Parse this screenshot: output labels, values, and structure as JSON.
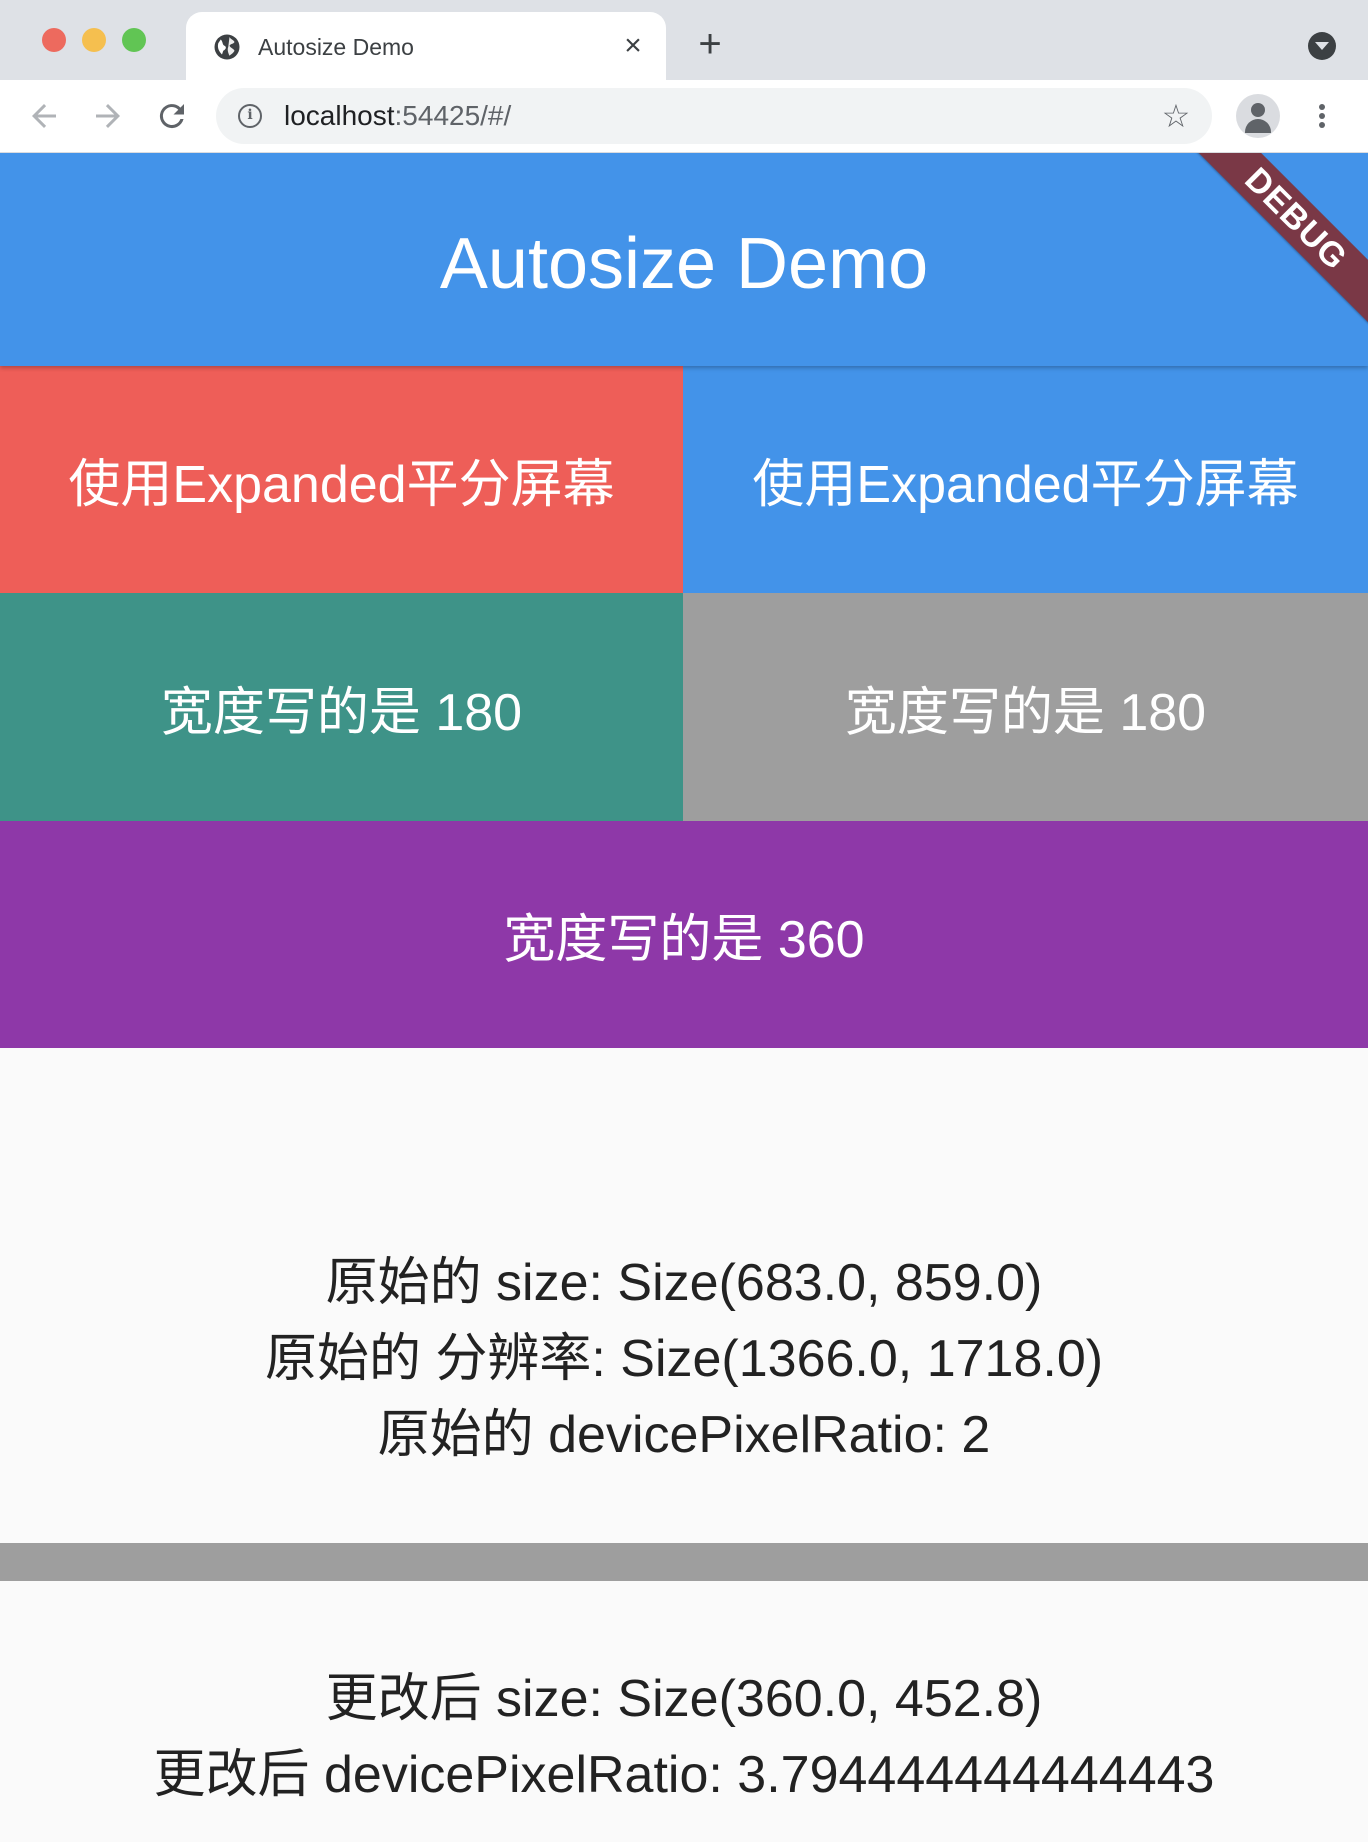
{
  "browser": {
    "tab_title": "Autosize Demo",
    "tab_close": "×",
    "new_tab": "+",
    "url_host": "localhost",
    "url_rest": ":54425/#/",
    "info_icon": "i",
    "star": "☆",
    "icons": [
      "globe-icon",
      "close-icon",
      "plus-icon",
      "tab-search-icon",
      "back-arrow-icon",
      "forward-arrow-icon",
      "reload-icon",
      "info-icon",
      "star-icon",
      "profile-icon",
      "kebab-menu-icon"
    ]
  },
  "appbar": {
    "title": "Autosize Demo",
    "debug_banner": "DEBUG",
    "color": "#4393e9"
  },
  "blocks": {
    "row1_left": "使用Expanded平分屏幕",
    "row1_right": "使用Expanded平分屏幕",
    "row2_left": "宽度写的是 180",
    "row2_right": "宽度写的是 180",
    "row3": "宽度写的是 360",
    "colors": {
      "red": "#ee5e58",
      "blue": "#4393e9",
      "teal": "#3e9388",
      "grey": "#9e9e9e",
      "purple": "#8e38a8"
    }
  },
  "original": {
    "size": "原始的 size: Size(683.0, 859.0)",
    "resolution": "原始的 分辨率: Size(1366.0, 1718.0)",
    "dpr": "原始的 devicePixelRatio: 2"
  },
  "changed": {
    "size": "更改后 size: Size(360.0, 452.8)",
    "dpr": "更改后 devicePixelRatio: 3.794444444444443"
  }
}
